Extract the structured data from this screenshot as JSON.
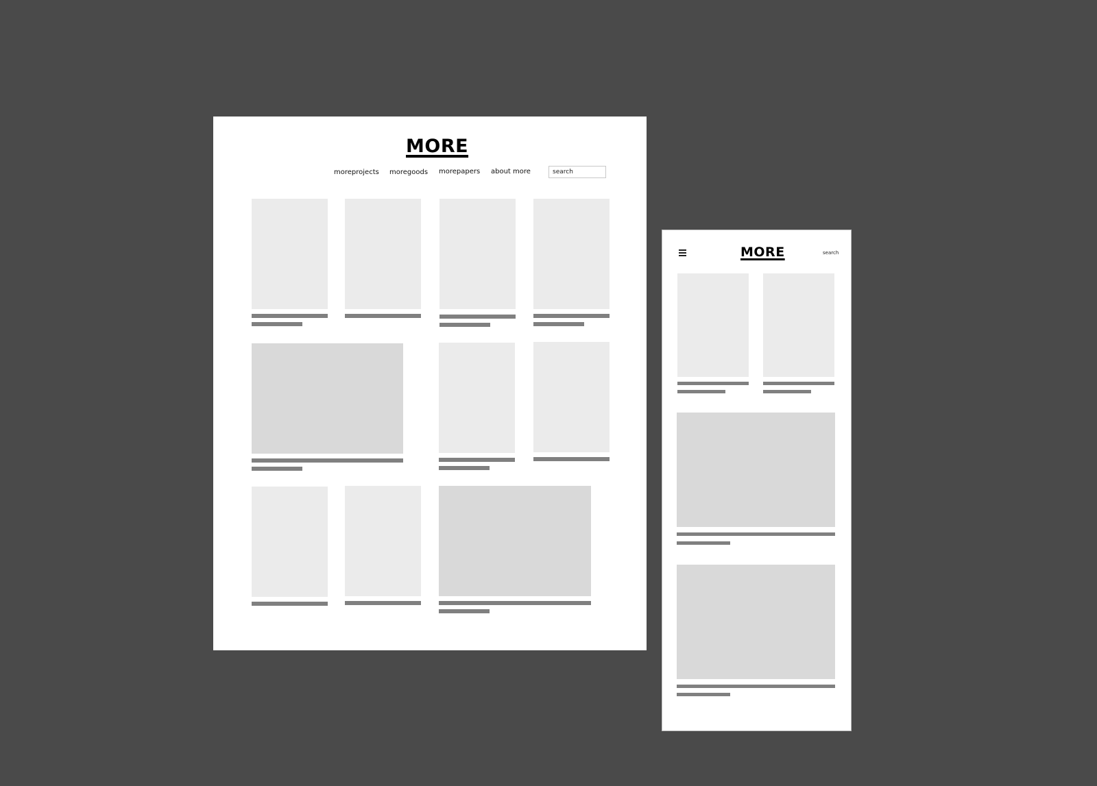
{
  "desktop": {
    "logo": "MORE",
    "nav": {
      "items": [
        {
          "label": "moreprojects"
        },
        {
          "label": "moregoods"
        },
        {
          "label": "morepapers"
        },
        {
          "label": "about more"
        }
      ]
    },
    "search": {
      "label": "search"
    }
  },
  "mobile": {
    "logo": "MORE",
    "menu_icon": "hamburger-menu-icon",
    "search": {
      "label": "search"
    }
  },
  "colors": {
    "canvas": "#4a4a4a",
    "frame": "#ffffff",
    "thumb_light": "#ebebeb",
    "thumb_dark": "#d9d9d9",
    "text_bar": "#808080"
  }
}
